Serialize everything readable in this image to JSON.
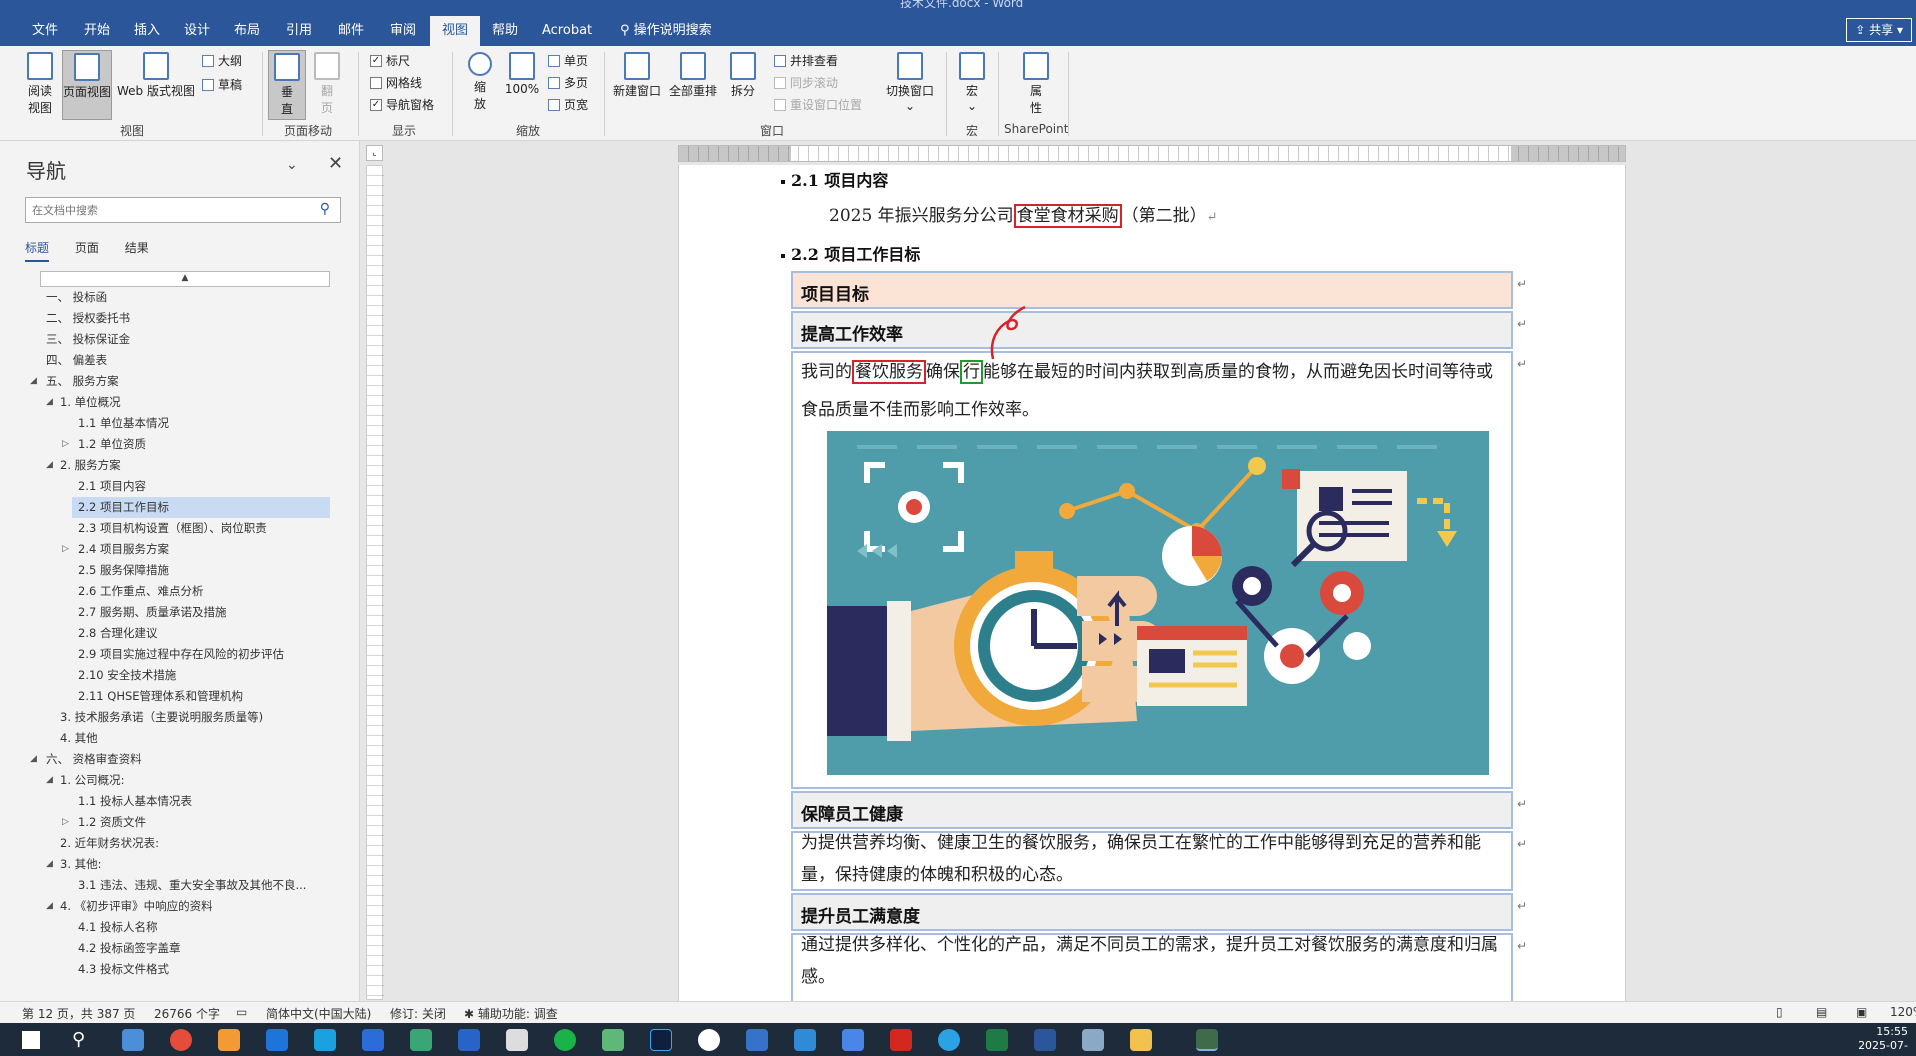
{
  "window": {
    "title": "技术文件.docx - Word"
  },
  "tabs": [
    "文件",
    "开始",
    "插入",
    "设计",
    "布局",
    "引用",
    "邮件",
    "审阅",
    "视图",
    "帮助",
    "Acrobat",
    "操作说明搜索"
  ],
  "active_tab": "视图",
  "share_label": "共享",
  "ribbon": {
    "views": {
      "read_mode": "阅读\n视图",
      "print_layout": "页面视图",
      "web_layout": "Web 版式视图",
      "outline": "大纲",
      "draft": "草稿",
      "group": "视图"
    },
    "page_movement": {
      "vertical": "垂\n直",
      "side": "翻\n页",
      "group": "页面移动"
    },
    "show": {
      "ruler": "标尺",
      "gridlines": "网格线",
      "nav_pane": "导航窗格",
      "group": "显示"
    },
    "zoom": {
      "zoom": "缩\n放",
      "hundred": "100%",
      "one_page": "单页",
      "multi_page": "多页",
      "page_width": "页宽",
      "group": "缩放"
    },
    "window": {
      "new_window": "新建窗口",
      "arrange_all": "全部重排",
      "split": "拆分",
      "side_by_side": "并排查看",
      "sync_scroll": "同步滚动",
      "reset_pos": "重设窗口位置",
      "switch": "切换窗口",
      "group": "窗口"
    },
    "macros": {
      "label": "宏",
      "group": "宏"
    },
    "sharepoint": {
      "label": "属\n性",
      "group": "SharePoint"
    }
  },
  "nav": {
    "title": "导航",
    "search_placeholder": "在文档中搜索",
    "tabs": [
      "标题",
      "页面",
      "结果"
    ],
    "items": [
      {
        "label": "一、 投标函",
        "level": 1,
        "tri": ""
      },
      {
        "label": "二、 授权委托书",
        "level": 1,
        "tri": ""
      },
      {
        "label": "三、 投标保证金",
        "level": 1,
        "tri": ""
      },
      {
        "label": "四、 偏差表",
        "level": 1,
        "tri": ""
      },
      {
        "label": "五、 服务方案",
        "level": 1,
        "tri": "◢"
      },
      {
        "label": "1. 单位概况",
        "level": 2,
        "tri": "◢"
      },
      {
        "label": "1.1  单位基本情况",
        "level": 3,
        "tri": ""
      },
      {
        "label": "1.2  单位资质",
        "level": 3,
        "tri": "▷"
      },
      {
        "label": "2. 服务方案",
        "level": 2,
        "tri": "◢"
      },
      {
        "label": "2.1  项目内容",
        "level": 3,
        "tri": ""
      },
      {
        "label": "2.2  项目工作目标",
        "level": 3,
        "tri": "",
        "active": true
      },
      {
        "label": "2.3  项目机构设置（框图）、岗位职责",
        "level": 3,
        "tri": ""
      },
      {
        "label": "2.4  项目服务方案",
        "level": 3,
        "tri": "▷"
      },
      {
        "label": "2.5  服务保障措施",
        "level": 3,
        "tri": ""
      },
      {
        "label": "2.6  工作重点、难点分析",
        "level": 3,
        "tri": ""
      },
      {
        "label": "2.7  服务期、质量承诺及措施",
        "level": 3,
        "tri": ""
      },
      {
        "label": "2.8  合理化建议",
        "level": 3,
        "tri": ""
      },
      {
        "label": "2.9  项目实施过程中存在风险的初步评估",
        "level": 3,
        "tri": ""
      },
      {
        "label": "2.10  安全技术措施",
        "level": 3,
        "tri": ""
      },
      {
        "label": "2.11  QHSE管理体系和管理机构",
        "level": 3,
        "tri": ""
      },
      {
        "label": "3. 技术服务承诺（主要说明服务质量等)",
        "level": 2,
        "tri": ""
      },
      {
        "label": "4. 其他",
        "level": 2,
        "tri": ""
      },
      {
        "label": "六、 资格审查资料",
        "level": 1,
        "tri": "◢"
      },
      {
        "label": "1. 公司概况:",
        "level": 2,
        "tri": "◢"
      },
      {
        "label": "1.1  投标人基本情况表",
        "level": 3,
        "tri": ""
      },
      {
        "label": "1.2  资质文件",
        "level": 3,
        "tri": "▷"
      },
      {
        "label": "2. 近年财务状况表:",
        "level": 2,
        "tri": ""
      },
      {
        "label": "3. 其他:",
        "level": 2,
        "tri": "◢"
      },
      {
        "label": "3.1  违法、违规、重大安全事故及其他不良...",
        "level": 3,
        "tri": ""
      },
      {
        "label": "4. 《初步评审》中响应的资料",
        "level": 2,
        "tri": "◢"
      },
      {
        "label": "4.1  投标人名称",
        "level": 3,
        "tri": ""
      },
      {
        "label": "4.2  投标函签字盖章",
        "level": 3,
        "tri": ""
      },
      {
        "label": "4.3  投标文件格式",
        "level": 3,
        "tri": ""
      }
    ]
  },
  "doc": {
    "h_2_1": "2.1  项目内容",
    "p1_pre": "2025 年振兴服务分公司",
    "p1_box": "食堂食材采购",
    "p1_post": "（第二批）",
    "h_2_2": "2.2  项目工作目标",
    "row_head": "项目目标",
    "row_efficiency": "提高工作效率",
    "eff_text_1": "我司的",
    "eff_box_red": "餐饮服务",
    "eff_text_2": "确保",
    "eff_box_green": "行",
    "eff_text_3": "能够在最短的时间内获取到高质量的食物，从而避免因长时间等待或食品质量不佳而影响工作效率。",
    "row_health": "保障员工健康",
    "health_text": "为提供营养均衡、健康卫生的餐饮服务，确保员工在繁忙的工作中能够得到充足的营养和能量，保持健康的体魄和积极的心态。",
    "row_satisfaction": "提升员工满意度",
    "satisfaction_text": "通过提供多样化、个性化的产品，满足不同员工的需求，提升员工对餐饮服务的满意度和归属感。"
  },
  "status": {
    "page": "第 12 页，共 387 页",
    "words": "26766 个字",
    "lang": "简体中文(中国大陆)",
    "track": "修订: 关闭",
    "access": "辅助功能: 调查",
    "zoom": "120%"
  },
  "taskbar": {
    "time": "15:55",
    "date": "2025-07-"
  },
  "colors": {
    "word_blue": "#2b579a",
    "red_box": "#d6232b",
    "green_box": "#1f9a2f",
    "table_head": "#fbe3d6"
  }
}
